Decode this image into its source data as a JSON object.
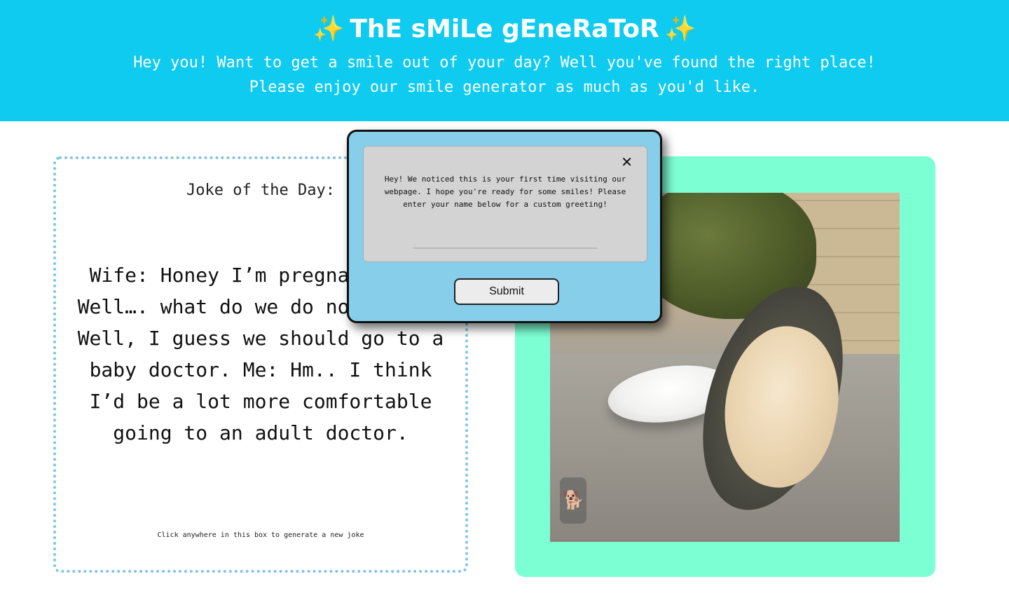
{
  "header": {
    "sparkle_left": "✨",
    "title": "ThE sMiLe gEneRaToR",
    "sparkle_right": "✨",
    "subtitle_line1": "Hey you! Want to get a smile out of your day? Well you've found the right place!",
    "subtitle_line2": "Please enjoy our smile generator as much as you'd like.",
    "background_color": "#0ecbef"
  },
  "joke": {
    "heading": "Joke of the Day:",
    "text": "Wife: Honey I’m pregnant. Me: Well…. what do we do now? Wife: Well, I guess we should go to a baby doctor. Me: Hm.. I think I’d be a lot more comfortable going to an adult doctor.",
    "hint": "Click anywhere in this box to generate a new joke",
    "border_color": "#7ec4e6"
  },
  "image_panel": {
    "frame_color": "#7dffd4",
    "watermark_icon": "dog-silhouette-icon"
  },
  "modal": {
    "close_symbol": "✕",
    "message": "Hey! We noticed this is your first time visiting our webpage. I hope you're ready for some smiles! Please enter your name below for a custom greeting!",
    "name_input_value": "",
    "submit_label": "Submit",
    "background_color": "#87ceeb"
  }
}
